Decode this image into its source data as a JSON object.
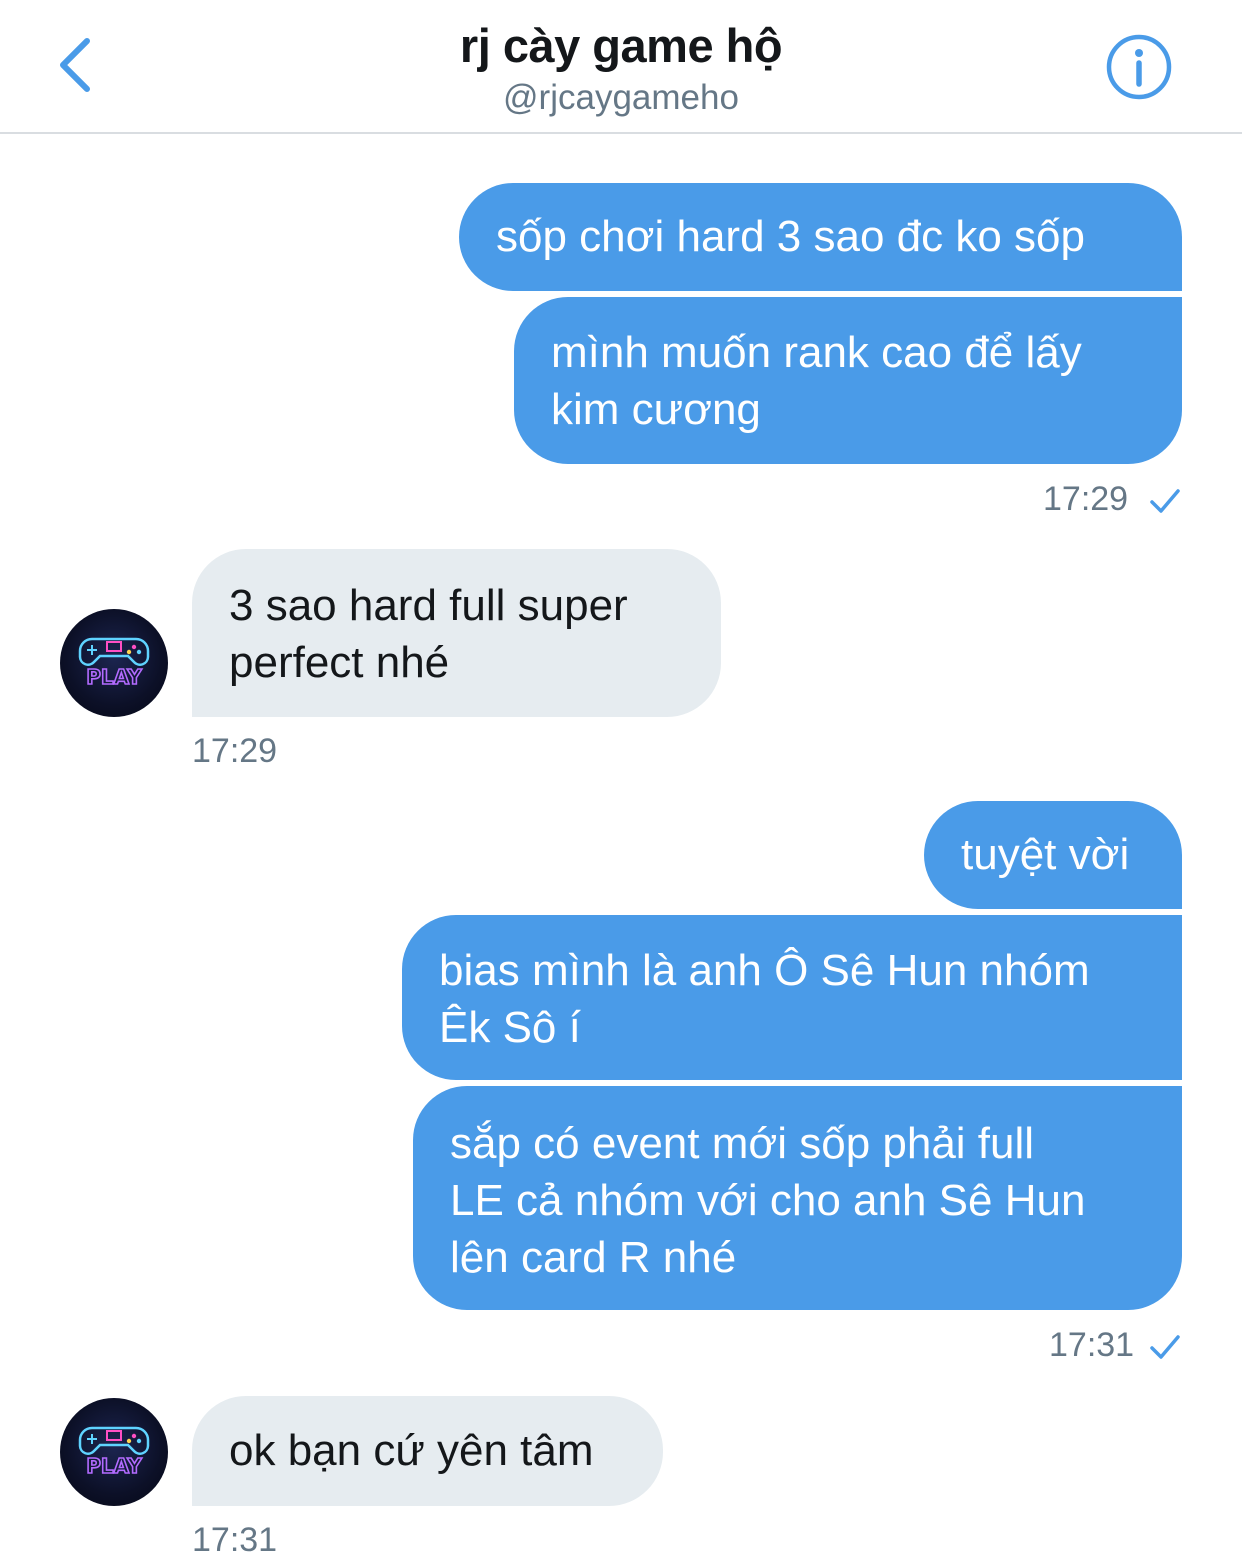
{
  "header": {
    "title": "rj cày game hộ",
    "handle": "@rjcaygameho",
    "back_icon": "chevron-left-icon",
    "info_icon": "info-icon",
    "accent_color": "#4a9be8"
  },
  "messages": [
    {
      "id": "m1",
      "direction": "outgoing",
      "text": "sốp chơi hard 3 sao đc ko sốp"
    },
    {
      "id": "m2",
      "direction": "outgoing",
      "text": "mình muốn rank cao để lấy\nkim cương"
    },
    {
      "id": "m3",
      "direction": "incoming",
      "text": "3 sao hard full super\nperfect nhé"
    },
    {
      "id": "m4",
      "direction": "outgoing",
      "text": "tuyệt vời"
    },
    {
      "id": "m5",
      "direction": "outgoing",
      "text": "bias mình là anh Ô Sê Hun nhóm\nÊk Sô í"
    },
    {
      "id": "m6",
      "direction": "outgoing",
      "text": "sắp có event mới sốp phải full\nLE cả nhóm với cho anh Sê Hun\nlên card R nhé"
    },
    {
      "id": "m7",
      "direction": "incoming",
      "text": "ok bạn cứ yên tâm"
    }
  ],
  "timestamps": {
    "t1": {
      "text": "17:29",
      "read": true
    },
    "t2": {
      "text": "17:29"
    },
    "t3": {
      "text": "17:31",
      "read": true
    },
    "t4": {
      "text": "17:31"
    }
  },
  "avatar": {
    "text": "PLAY"
  },
  "colors": {
    "outgoing_bubble": "#4a9be8",
    "incoming_bubble": "#e6ecf0",
    "timestamp": "#657786"
  }
}
